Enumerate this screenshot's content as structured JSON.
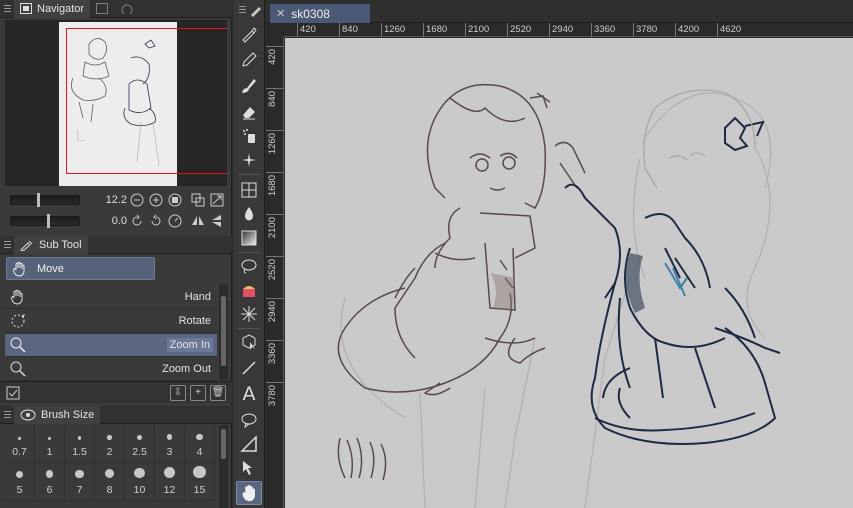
{
  "navigator": {
    "tab_label": "Navigator",
    "zoom_value": "12.2",
    "rotate_value": "0.0"
  },
  "subtool": {
    "tab_label": "Sub Tool",
    "group_label": "Move",
    "items": [
      {
        "label": "Hand",
        "icon": "hand-icon"
      },
      {
        "label": "Rotate",
        "icon": "rotate-icon"
      },
      {
        "label": "Zoom In",
        "icon": "zoom-icon",
        "selected": true
      },
      {
        "label": "Zoom Out",
        "icon": "zoom-icon"
      }
    ]
  },
  "brush_size": {
    "tab_label": "Brush Size",
    "values": [
      "0.7",
      "1",
      "1.5",
      "2",
      "2.5",
      "3",
      "4",
      "5",
      "6",
      "7",
      "8",
      "10",
      "12",
      "15"
    ]
  },
  "document": {
    "tab_title": "sk0308"
  },
  "ruler": {
    "top": [
      "420",
      "840",
      "1260",
      "1680",
      "2100",
      "2520",
      "2940",
      "3360",
      "3780",
      "4200",
      "4620"
    ],
    "left": [
      "420",
      "840",
      "1260",
      "1680",
      "2100",
      "2520",
      "2940",
      "3360",
      "3780"
    ]
  },
  "colors": {
    "selection": "#5a6580",
    "navigator_frame": "#e01818",
    "canvas": "#cacaca",
    "sketch_brown": "#5a4a4a",
    "sketch_navy": "#1e2a44"
  }
}
